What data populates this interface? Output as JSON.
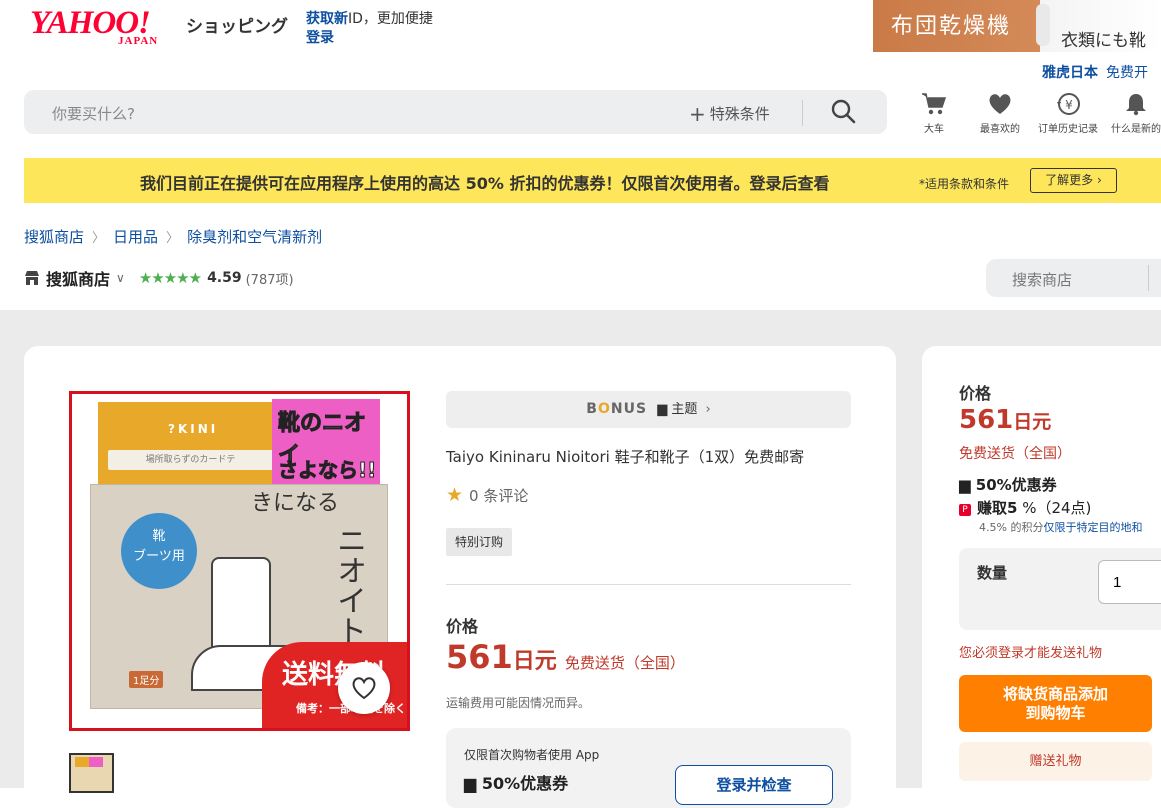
{
  "header": {
    "logo_main": "YAHOO!",
    "logo_sub": "JAPAN",
    "shop_title": "ショッピング",
    "login_prompt_bold": "获取新",
    "login_prompt_text": "ID，更加便捷",
    "login_link": "登录",
    "ad_text_1": "布団乾燥機",
    "ad_text_2": "衣類にも靴",
    "yahoo_japan_link": "雅虎日本",
    "free_open_link": "免费开"
  },
  "search": {
    "placeholder": "你要买什么?",
    "special_conditions": "特殊条件"
  },
  "header_icons": [
    {
      "label": "大车",
      "icon": "cart-icon"
    },
    {
      "label": "最喜欢的",
      "icon": "heart-icon"
    },
    {
      "label": "订单历史记录",
      "icon": "order-history-icon"
    },
    {
      "label": "什么是新的",
      "icon": "bell-icon"
    }
  ],
  "promo": {
    "text": "我们目前正在提供可在应用程序上使用的高达 50% 折扣的优惠券！仅限首次使用者。登录后查看",
    "note": "*适用条款和条件",
    "button": "了解更多"
  },
  "breadcrumb": [
    "搜狐商店",
    "日用品",
    "除臭剂和空气清新剂"
  ],
  "store": {
    "name": "搜狐商店",
    "stars": "★★★★★",
    "rating": "4.59",
    "count": "(787项)",
    "search_placeholder": "搜索商店"
  },
  "product_image": {
    "kini_text": "?KINI",
    "card_text": "場所取らずのカードテ",
    "pink_text_1": "靴のニオイ",
    "pink_text_2": "さよなら!!",
    "boot_circle_1": "靴",
    "boot_circle_2": "ブーツ用",
    "kininaru": "きになる",
    "nioitori": "ニオイトリ",
    "one_pair": "1足分",
    "free_ship": "送料無料",
    "free_ship_note": "備考：一部地域を除く"
  },
  "product": {
    "bonus_logo_b": "B",
    "bonus_logo_o": "O",
    "bonus_logo_rest": "NUS",
    "bonus_topic": "主题",
    "title": "Taiyo Kininaru Nioitori 鞋子和靴子（1双）免费邮寄",
    "review_count": "0 条评论",
    "tag": "特别订购",
    "price_label": "价格",
    "price_num": "561",
    "price_unit": "日元",
    "shipping": "免费送货（全国）",
    "shipping_note": "运输费用可能因情况而异。",
    "coupon_note": "仅限首次购物者使用 App",
    "coupon_title": "50%优惠券",
    "coupon_button": "登录并检查"
  },
  "side": {
    "price_label": "价格",
    "price_num": "561",
    "price_unit": "日元",
    "shipping": "免费送货（全国）",
    "coupon": "50%优惠券",
    "earn_label": "赚取5",
    "earn_rest": "%（24点)",
    "points_text": "4.5% 的积分",
    "points_link": "仅限于特定目的地和",
    "qty_label": "数量",
    "qty_value": "1",
    "login_note": "您必须登录才能发送礼物",
    "cart_button_1": "将缺货商品添加",
    "cart_button_2": "到购物车",
    "gift_button": "赠送礼物"
  },
  "colors": {
    "brand_red": "#ff0033",
    "link_blue": "#0e4fa1",
    "price_red": "#c0392b",
    "promo_yellow": "#fde65a",
    "cart_orange": "#ff7f00"
  }
}
